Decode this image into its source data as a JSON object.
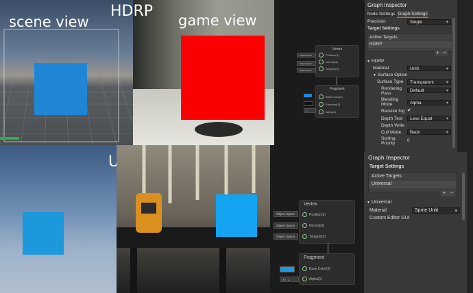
{
  "overlay": {
    "hdrp": "HDRP",
    "scene_view": "scene view",
    "game_view": "game view",
    "urp": "URP"
  },
  "colors": {
    "blue_quad": "#1f86d6",
    "urp_quad": "#1c98dd",
    "red_quad": "#fa0000",
    "cyan_quad": "#14a3f0"
  },
  "hdrp_inspector": {
    "title": "Graph Inspector",
    "tabs": [
      "Node Settings",
      "Graph Settings"
    ],
    "precision_label": "Precision",
    "precision_value": "Single",
    "target_settings": "Target Settings",
    "active_targets": "Active Targets",
    "target_item": "HDRP",
    "section": "HDRP",
    "material_label": "Material",
    "material_value": "Unlit",
    "surface_options": "Surface Option",
    "surface_type_label": "Surface Type",
    "surface_type_value": "Transparent",
    "rendering_pass_label": "Rendering Pass",
    "rendering_pass_value": "Default",
    "blending_mode_label": "Blending Mode",
    "blending_mode_value": "Alpha",
    "receive_fog_label": "Receive fog",
    "depth_test_label": "Depth Test",
    "depth_test_value": "Less Equal",
    "depth_write_label": "Depth Write",
    "cull_mode_label": "Cull Mode",
    "cull_mode_value": "Back",
    "sorting_priority_label": "Sorting Priority",
    "sorting_priority_value": "0"
  },
  "urp_inspector": {
    "title": "Graph Inspector",
    "target_settings": "Target Settings",
    "active_targets": "Active Targets",
    "target_item": "Universal",
    "section": "Universal",
    "material_label": "Material",
    "material_value": "Sprite Unlit",
    "custom_editor_label": "Custom Editor GUI"
  },
  "hdrp_graph": {
    "vertex_title": "Vertex",
    "vertex_ports": [
      "Position(3)",
      "Normal(3)",
      "Tangent(3)"
    ],
    "vertex_slot": "Object Space",
    "fragment_title": "Fragment",
    "fragment_ports": [
      "Base Color(3)",
      "Emission(3)",
      "Alpha(1)"
    ],
    "alpha_value": "1"
  },
  "urp_graph": {
    "vertex_title": "Vertex",
    "vertex_ports": [
      "Position(3)",
      "Normal(3)",
      "Tangent(3)"
    ],
    "vertex_slot": "Object Space",
    "fragment_title": "Fragment",
    "fragment_ports": [
      "Base Color(3)",
      "Alpha(1)"
    ],
    "alpha_x": "X",
    "alpha_value": "1"
  }
}
